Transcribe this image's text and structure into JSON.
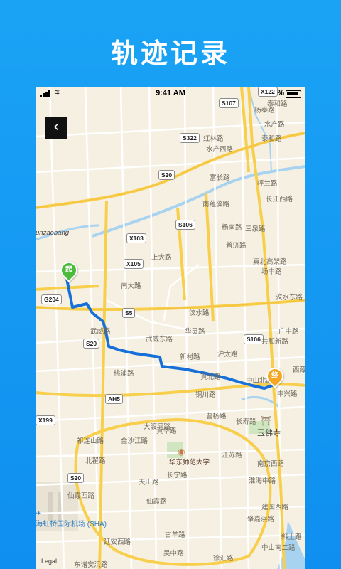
{
  "headline": "轨迹记录",
  "status_bar": {
    "time": "9:41 AM",
    "battery": "100%"
  },
  "back_button": {
    "glyph": "‹"
  },
  "track": {
    "start_label": "起",
    "end_label": "终",
    "route_color": "#1670d8"
  },
  "map": {
    "legal": "Legal",
    "airport": "海虹桥国际机场 (SHA)",
    "area_label": "unzaobang",
    "landmark": "华东师范大学",
    "temple": "玉佛寺",
    "shields": [
      "S107",
      "X122",
      "S322",
      "S20",
      "S106",
      "X103",
      "X105",
      "G204",
      "S5",
      "S20",
      "S106",
      "AH5",
      "X199",
      "S20"
    ],
    "roads": [
      "红林路",
      "水产西路",
      "泰和路",
      "水产路",
      "杨泰路",
      "呼兰路",
      "富长路",
      "南蕴藻路",
      "长江西路",
      "三泉路",
      "上大路",
      "真北高架路",
      "普济路",
      "汶水东路",
      "南大路",
      "场中路",
      "汶水路",
      "武威路",
      "武威东路",
      "华灵路",
      "广中路",
      "沪太路",
      "共和新路",
      "西藏北路",
      "铜川路",
      "真北路",
      "新村路",
      "中山北路",
      "中兴路",
      "桃浦路",
      "长寿路",
      "曹杨路",
      "金沙江路",
      "真华路",
      "长宁路",
      "天山路",
      "仙霞西路",
      "北翟路",
      "仙霞路",
      "淮海中路",
      "中山南二路",
      "延安西路",
      "古羊路",
      "肇嘉浜路",
      "吴中路",
      "徐汇路",
      "东诸安浜路",
      "江苏路",
      "南京西路",
      "建国西路",
      "斜土路",
      "祁连山路",
      "大渡河路",
      "泰和路",
      "杨南路"
    ]
  }
}
